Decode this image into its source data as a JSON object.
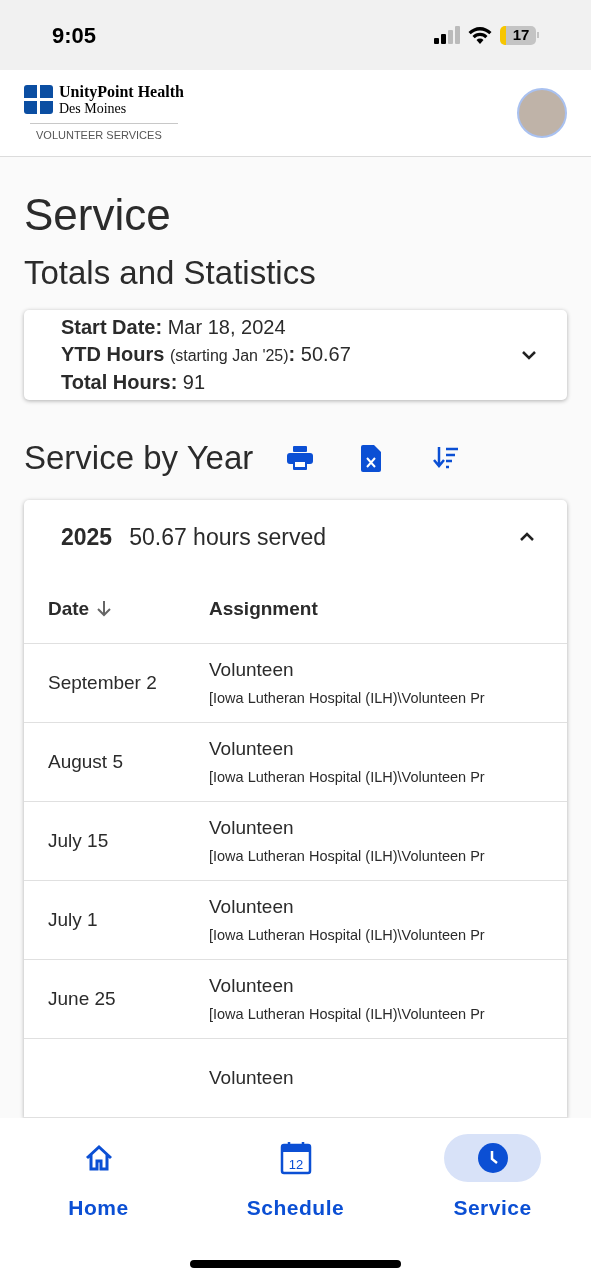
{
  "status_bar": {
    "time": "9:05",
    "battery": "17"
  },
  "header": {
    "org": "UnityPoint Health",
    "city": "Des Moines",
    "unit": "VOLUNTEER SERVICES"
  },
  "page_title": "Service",
  "totals": {
    "title": "Totals and Statistics",
    "expanded": false,
    "lines": [
      {
        "label": "Start Date:",
        "value": "Mar 18, 2024"
      },
      {
        "label": "YTD Hours",
        "note": "(starting Jan '25)",
        "separator": ":",
        "value": "50.67"
      },
      {
        "label": "Total Hours:",
        "value": "91"
      }
    ]
  },
  "service_by_year": {
    "title": "Service by Year",
    "year": "2025",
    "summary": "50.67 hours served",
    "expanded": true,
    "columns": [
      "Date",
      "Assignment"
    ],
    "rows": [
      {
        "date": "September 2",
        "assignment": "Volunteen",
        "location": "[Iowa Lutheran Hospital (ILH)\\Volunteen Pr"
      },
      {
        "date": "August 5",
        "assignment": "Volunteen",
        "location": "[Iowa Lutheran Hospital (ILH)\\Volunteen Pr"
      },
      {
        "date": "July 15",
        "assignment": "Volunteen",
        "location": "[Iowa Lutheran Hospital (ILH)\\Volunteen Pr"
      },
      {
        "date": "July 1",
        "assignment": "Volunteen",
        "location": "[Iowa Lutheran Hospital (ILH)\\Volunteen Pr"
      },
      {
        "date": "June 25",
        "assignment": "Volunteen",
        "location": "[Iowa Lutheran Hospital (ILH)\\Volunteen Pr"
      },
      {
        "assignment": "Volunteen"
      }
    ]
  },
  "nav": [
    {
      "kind": "home",
      "label": "Home",
      "selected": false
    },
    {
      "kind": "schedule",
      "label": "Schedule",
      "icon_text": "12",
      "selected": false
    },
    {
      "kind": "service",
      "label": "Service",
      "selected": true
    }
  ]
}
